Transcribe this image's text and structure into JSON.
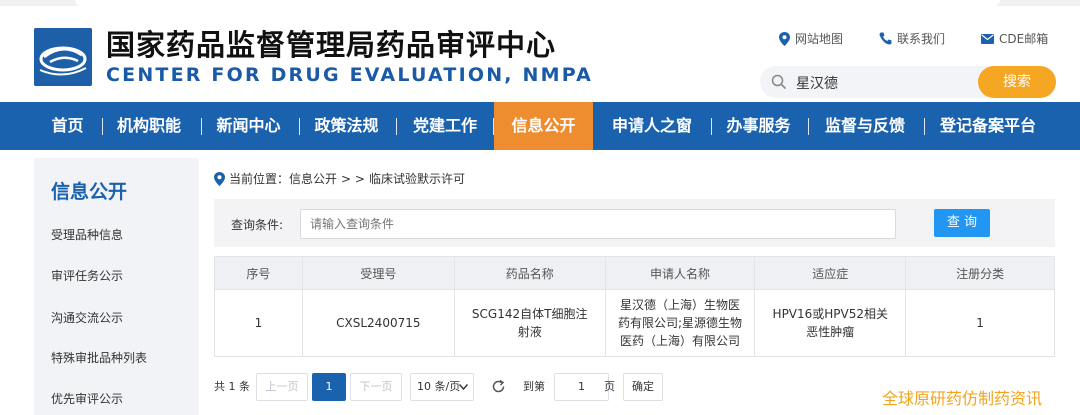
{
  "header": {
    "title_cn": "国家药品监督管理局药品审评中心",
    "title_en": "CENTER FOR DRUG EVALUATION, NMPA",
    "links": {
      "sitemap": "网站地图",
      "contact": "联系我们",
      "mail": "CDE邮箱"
    },
    "search": {
      "value": "星汉德",
      "button": "搜索"
    }
  },
  "nav": {
    "items": [
      "首页",
      "机构职能",
      "新闻中心",
      "政策法规",
      "党建工作",
      "信息公开",
      "申请人之窗",
      "办事服务",
      "监督与反馈",
      "登记备案平台"
    ],
    "active": "信息公开"
  },
  "sidebar": {
    "title": "信息公开",
    "items": [
      "受理品种信息",
      "审评任务公示",
      "沟通交流公示",
      "特殊审批品种列表",
      "优先审评公示"
    ]
  },
  "breadcrumb": {
    "prefix": "当前位置：信息公开",
    "sep": "> >",
    "current": "临床试验默示许可"
  },
  "query": {
    "label": "查询条件:",
    "placeholder": "请输入查询条件",
    "button": "查 询"
  },
  "table": {
    "headers": [
      "序号",
      "受理号",
      "药品名称",
      "申请人名称",
      "适应症",
      "注册分类"
    ],
    "rows": [
      [
        "1",
        "CXSL2400715",
        "SCG142自体T细胞注射液",
        "星汉德（上海）生物医药有限公司;星源德生物医药（上海）有限公司",
        "HPV16或HPV52相关恶性肿瘤",
        "1"
      ]
    ]
  },
  "pager": {
    "total": "共 1 条",
    "prev": "上一页",
    "page": "1",
    "next": "下一页",
    "page_size": "10 条/页",
    "goto": "到第",
    "goto_value": "1",
    "page_unit": "页",
    "confirm": "确定"
  },
  "watermark": "全球原研药仿制药资讯",
  "colors": {
    "primary_blue": "#1a62ad",
    "active_orange": "#ee8d2f",
    "search_orange": "#f5a623",
    "query_blue": "#2196f3"
  }
}
